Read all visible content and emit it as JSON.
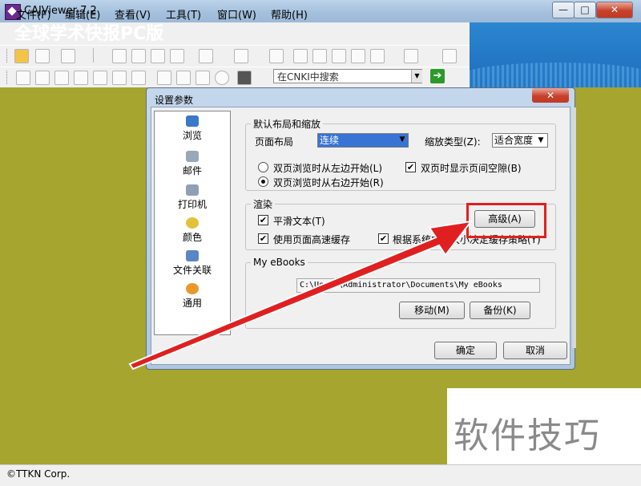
{
  "window": {
    "title": "CAJViewer 7.2"
  },
  "title_buttons": {
    "minimize": "—",
    "maximize": "□",
    "close": "✕"
  },
  "menu": [
    "文件(F)",
    "编辑(E)",
    "查看(V)",
    "工具(T)",
    "窗口(W)",
    "帮助(H)"
  ],
  "search": {
    "placeholder": "在CNKI中搜索",
    "go": "➔"
  },
  "banner": {
    "text": "全球学术快报PC版"
  },
  "status": {
    "text": "©TTKN Corp."
  },
  "dialog": {
    "title": "设置参数",
    "close": "✕",
    "nav": [
      "浏览",
      "邮件",
      "打印机",
      "颜色",
      "文件关联",
      "通用"
    ],
    "layout_group": {
      "legend": "默认布局和缩放",
      "page_layout_label": "页面布局",
      "page_layout_value": "连续",
      "zoom_type_label": "缩放类型(Z):",
      "zoom_type_value": "适合宽度",
      "radio_left": "双页浏览时从左边开始(L)",
      "radio_right": "双页浏览时从右边开始(R)",
      "show_gap": "双页时显示页间空隙(B)"
    },
    "render_group": {
      "legend": "渲染",
      "smooth_text": "平滑文本(T)",
      "fast_cache": "使用页面高速缓存",
      "by_system": "根据系统内存大小决定缓存策略(Y)",
      "advanced_button": "高级(A)"
    },
    "ebooks_group": {
      "legend": "My eBooks",
      "path": "C:\\Users\\Administrator\\Documents\\My eBooks",
      "move_button": "移动(M)",
      "backup_button": "备份(K)"
    },
    "ok_button": "确定",
    "cancel_button": "取消"
  },
  "watermark": {
    "text": "软件技巧"
  }
}
